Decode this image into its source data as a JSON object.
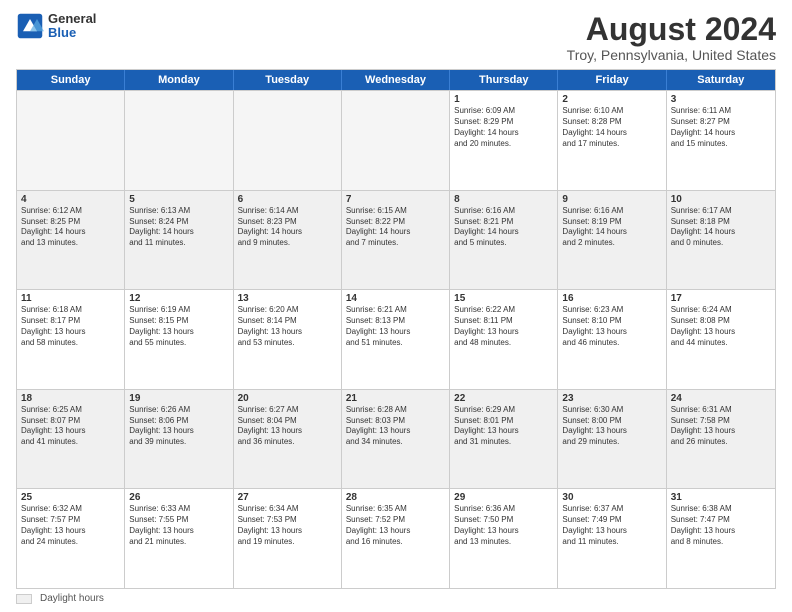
{
  "logo": {
    "general": "General",
    "blue": "Blue"
  },
  "title": "August 2024",
  "subtitle": "Troy, Pennsylvania, United States",
  "days": [
    "Sunday",
    "Monday",
    "Tuesday",
    "Wednesday",
    "Thursday",
    "Friday",
    "Saturday"
  ],
  "legend": {
    "label": "Daylight hours"
  },
  "weeks": [
    [
      {
        "day": "",
        "empty": true
      },
      {
        "day": "",
        "empty": true
      },
      {
        "day": "",
        "empty": true
      },
      {
        "day": "",
        "empty": true
      },
      {
        "day": "1",
        "line1": "Sunrise: 6:09 AM",
        "line2": "Sunset: 8:29 PM",
        "line3": "Daylight: 14 hours",
        "line4": "and 20 minutes.",
        "shaded": false
      },
      {
        "day": "2",
        "line1": "Sunrise: 6:10 AM",
        "line2": "Sunset: 8:28 PM",
        "line3": "Daylight: 14 hours",
        "line4": "and 17 minutes.",
        "shaded": false
      },
      {
        "day": "3",
        "line1": "Sunrise: 6:11 AM",
        "line2": "Sunset: 8:27 PM",
        "line3": "Daylight: 14 hours",
        "line4": "and 15 minutes.",
        "shaded": false
      }
    ],
    [
      {
        "day": "4",
        "line1": "Sunrise: 6:12 AM",
        "line2": "Sunset: 8:25 PM",
        "line3": "Daylight: 14 hours",
        "line4": "and 13 minutes.",
        "shaded": true
      },
      {
        "day": "5",
        "line1": "Sunrise: 6:13 AM",
        "line2": "Sunset: 8:24 PM",
        "line3": "Daylight: 14 hours",
        "line4": "and 11 minutes.",
        "shaded": true
      },
      {
        "day": "6",
        "line1": "Sunrise: 6:14 AM",
        "line2": "Sunset: 8:23 PM",
        "line3": "Daylight: 14 hours",
        "line4": "and 9 minutes.",
        "shaded": true
      },
      {
        "day": "7",
        "line1": "Sunrise: 6:15 AM",
        "line2": "Sunset: 8:22 PM",
        "line3": "Daylight: 14 hours",
        "line4": "and 7 minutes.",
        "shaded": true
      },
      {
        "day": "8",
        "line1": "Sunrise: 6:16 AM",
        "line2": "Sunset: 8:21 PM",
        "line3": "Daylight: 14 hours",
        "line4": "and 5 minutes.",
        "shaded": true
      },
      {
        "day": "9",
        "line1": "Sunrise: 6:16 AM",
        "line2": "Sunset: 8:19 PM",
        "line3": "Daylight: 14 hours",
        "line4": "and 2 minutes.",
        "shaded": true
      },
      {
        "day": "10",
        "line1": "Sunrise: 6:17 AM",
        "line2": "Sunset: 8:18 PM",
        "line3": "Daylight: 14 hours",
        "line4": "and 0 minutes.",
        "shaded": true
      }
    ],
    [
      {
        "day": "11",
        "line1": "Sunrise: 6:18 AM",
        "line2": "Sunset: 8:17 PM",
        "line3": "Daylight: 13 hours",
        "line4": "and 58 minutes.",
        "shaded": false
      },
      {
        "day": "12",
        "line1": "Sunrise: 6:19 AM",
        "line2": "Sunset: 8:15 PM",
        "line3": "Daylight: 13 hours",
        "line4": "and 55 minutes.",
        "shaded": false
      },
      {
        "day": "13",
        "line1": "Sunrise: 6:20 AM",
        "line2": "Sunset: 8:14 PM",
        "line3": "Daylight: 13 hours",
        "line4": "and 53 minutes.",
        "shaded": false
      },
      {
        "day": "14",
        "line1": "Sunrise: 6:21 AM",
        "line2": "Sunset: 8:13 PM",
        "line3": "Daylight: 13 hours",
        "line4": "and 51 minutes.",
        "shaded": false
      },
      {
        "day": "15",
        "line1": "Sunrise: 6:22 AM",
        "line2": "Sunset: 8:11 PM",
        "line3": "Daylight: 13 hours",
        "line4": "and 48 minutes.",
        "shaded": false
      },
      {
        "day": "16",
        "line1": "Sunrise: 6:23 AM",
        "line2": "Sunset: 8:10 PM",
        "line3": "Daylight: 13 hours",
        "line4": "and 46 minutes.",
        "shaded": false
      },
      {
        "day": "17",
        "line1": "Sunrise: 6:24 AM",
        "line2": "Sunset: 8:08 PM",
        "line3": "Daylight: 13 hours",
        "line4": "and 44 minutes.",
        "shaded": false
      }
    ],
    [
      {
        "day": "18",
        "line1": "Sunrise: 6:25 AM",
        "line2": "Sunset: 8:07 PM",
        "line3": "Daylight: 13 hours",
        "line4": "and 41 minutes.",
        "shaded": true
      },
      {
        "day": "19",
        "line1": "Sunrise: 6:26 AM",
        "line2": "Sunset: 8:06 PM",
        "line3": "Daylight: 13 hours",
        "line4": "and 39 minutes.",
        "shaded": true
      },
      {
        "day": "20",
        "line1": "Sunrise: 6:27 AM",
        "line2": "Sunset: 8:04 PM",
        "line3": "Daylight: 13 hours",
        "line4": "and 36 minutes.",
        "shaded": true
      },
      {
        "day": "21",
        "line1": "Sunrise: 6:28 AM",
        "line2": "Sunset: 8:03 PM",
        "line3": "Daylight: 13 hours",
        "line4": "and 34 minutes.",
        "shaded": true
      },
      {
        "day": "22",
        "line1": "Sunrise: 6:29 AM",
        "line2": "Sunset: 8:01 PM",
        "line3": "Daylight: 13 hours",
        "line4": "and 31 minutes.",
        "shaded": true
      },
      {
        "day": "23",
        "line1": "Sunrise: 6:30 AM",
        "line2": "Sunset: 8:00 PM",
        "line3": "Daylight: 13 hours",
        "line4": "and 29 minutes.",
        "shaded": true
      },
      {
        "day": "24",
        "line1": "Sunrise: 6:31 AM",
        "line2": "Sunset: 7:58 PM",
        "line3": "Daylight: 13 hours",
        "line4": "and 26 minutes.",
        "shaded": true
      }
    ],
    [
      {
        "day": "25",
        "line1": "Sunrise: 6:32 AM",
        "line2": "Sunset: 7:57 PM",
        "line3": "Daylight: 13 hours",
        "line4": "and 24 minutes.",
        "shaded": false
      },
      {
        "day": "26",
        "line1": "Sunrise: 6:33 AM",
        "line2": "Sunset: 7:55 PM",
        "line3": "Daylight: 13 hours",
        "line4": "and 21 minutes.",
        "shaded": false
      },
      {
        "day": "27",
        "line1": "Sunrise: 6:34 AM",
        "line2": "Sunset: 7:53 PM",
        "line3": "Daylight: 13 hours",
        "line4": "and 19 minutes.",
        "shaded": false
      },
      {
        "day": "28",
        "line1": "Sunrise: 6:35 AM",
        "line2": "Sunset: 7:52 PM",
        "line3": "Daylight: 13 hours",
        "line4": "and 16 minutes.",
        "shaded": false
      },
      {
        "day": "29",
        "line1": "Sunrise: 6:36 AM",
        "line2": "Sunset: 7:50 PM",
        "line3": "Daylight: 13 hours",
        "line4": "and 13 minutes.",
        "shaded": false
      },
      {
        "day": "30",
        "line1": "Sunrise: 6:37 AM",
        "line2": "Sunset: 7:49 PM",
        "line3": "Daylight: 13 hours",
        "line4": "and 11 minutes.",
        "shaded": false
      },
      {
        "day": "31",
        "line1": "Sunrise: 6:38 AM",
        "line2": "Sunset: 7:47 PM",
        "line3": "Daylight: 13 hours",
        "line4": "and 8 minutes.",
        "shaded": false
      }
    ]
  ]
}
